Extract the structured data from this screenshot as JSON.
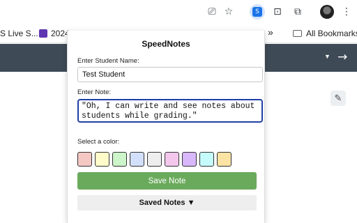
{
  "toolbar": {
    "ext_badge": "S",
    "menu_glyph": "⋮"
  },
  "bookmarks": {
    "item1": "S Live S...",
    "item2": "2024",
    "overflow": "»",
    "all_bookmarks": "All Bookmarks"
  },
  "popup": {
    "title": "SpeedNotes",
    "name_label": "Enter Student Name:",
    "name_value": "Test Student",
    "note_label": "Enter Note:",
    "note_value": "\"Oh, I can write and see notes about students while grading.\"",
    "color_label": "Select a color:",
    "colors": [
      "#f4c7c3",
      "#fffcc9",
      "#ccf5c9",
      "#d3e0fb",
      "#eeeeee",
      "#f3c7ec",
      "#d8b8fb",
      "#c6fbfb",
      "#fbe3a4"
    ],
    "save_label": "Save Note",
    "saved_label": "Saved Notes ▼"
  },
  "icons": [
    "install-app-icon",
    "star-icon",
    "speednotes-extension-icon",
    "extension-2-icon",
    "puzzle-icon",
    "avatar",
    "menu-icon",
    "sheets-icon",
    "folder-icon",
    "caret-icon",
    "arrow-right-icon",
    "pencil-icon"
  ]
}
